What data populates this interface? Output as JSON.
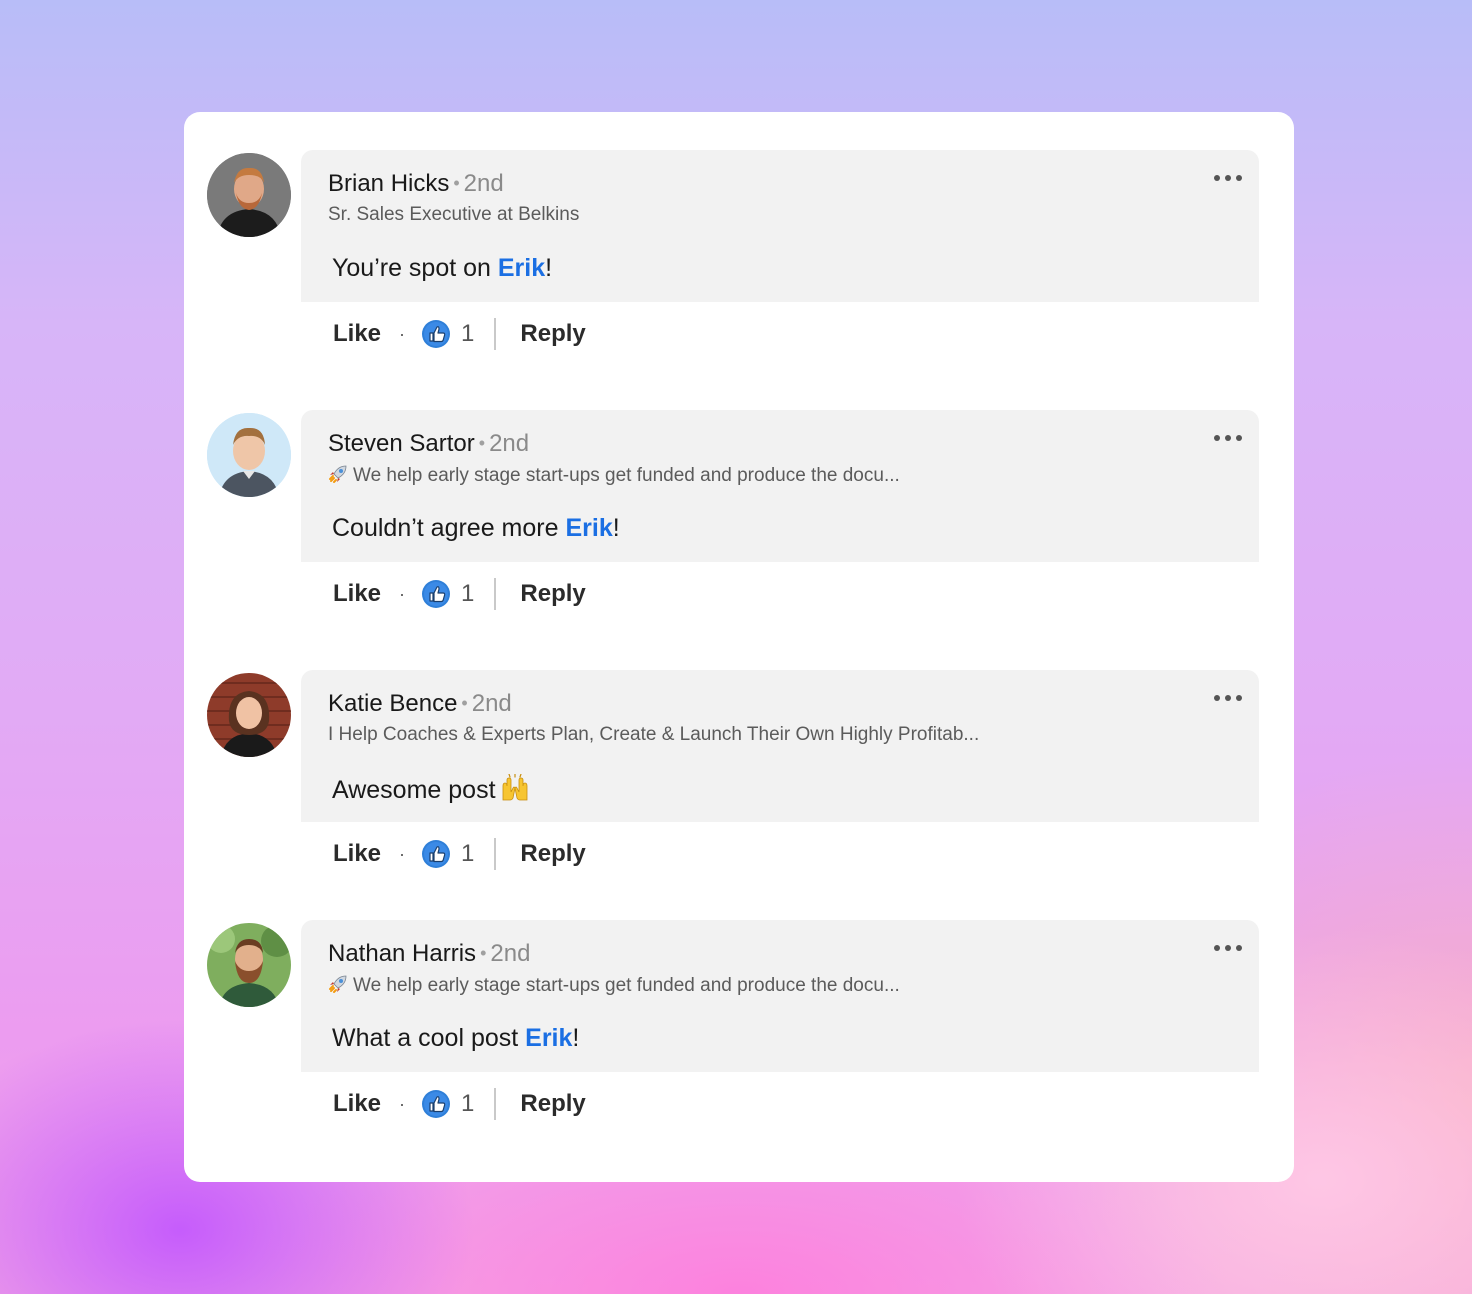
{
  "comments": [
    {
      "name": "Brian Hicks",
      "degree": "2nd",
      "headline": "Sr. Sales Executive at Belkins",
      "headline_icon": "",
      "message_before": "You’re spot on ",
      "mention": "Erik",
      "message_after": "!",
      "emoji": "",
      "like_label": "Like",
      "reaction_count": "1",
      "reply_label": "Reply"
    },
    {
      "name": "Steven Sartor",
      "degree": "2nd",
      "headline": "We help early stage start-ups get funded and produce the docu...",
      "headline_icon": "rocket-icon",
      "message_before": "Couldn’t agree more ",
      "mention": "Erik",
      "message_after": "!",
      "emoji": "",
      "like_label": "Like",
      "reaction_count": "1",
      "reply_label": "Reply"
    },
    {
      "name": "Katie Bence",
      "degree": "2nd",
      "headline": "I Help Coaches & Experts Plan, Create & Launch Their Own Highly Profitab...",
      "headline_icon": "",
      "message_before": "Awesome post",
      "mention": "",
      "message_after": "",
      "emoji": "raising-hands-icon",
      "like_label": "Like",
      "reaction_count": "1",
      "reply_label": "Reply"
    },
    {
      "name": "Nathan Harris",
      "degree": "2nd",
      "headline": "We help early stage start-ups get funded and produce the docu...",
      "headline_icon": "rocket-icon",
      "message_before": "What a cool post ",
      "mention": "Erik",
      "message_after": "!",
      "emoji": "",
      "like_label": "Like",
      "reaction_count": "1",
      "reply_label": "Reply"
    }
  ],
  "colors": {
    "mention": "#1b6fe3",
    "bubble": "#f2f2f2",
    "like_reaction": "#2f7fd8"
  }
}
